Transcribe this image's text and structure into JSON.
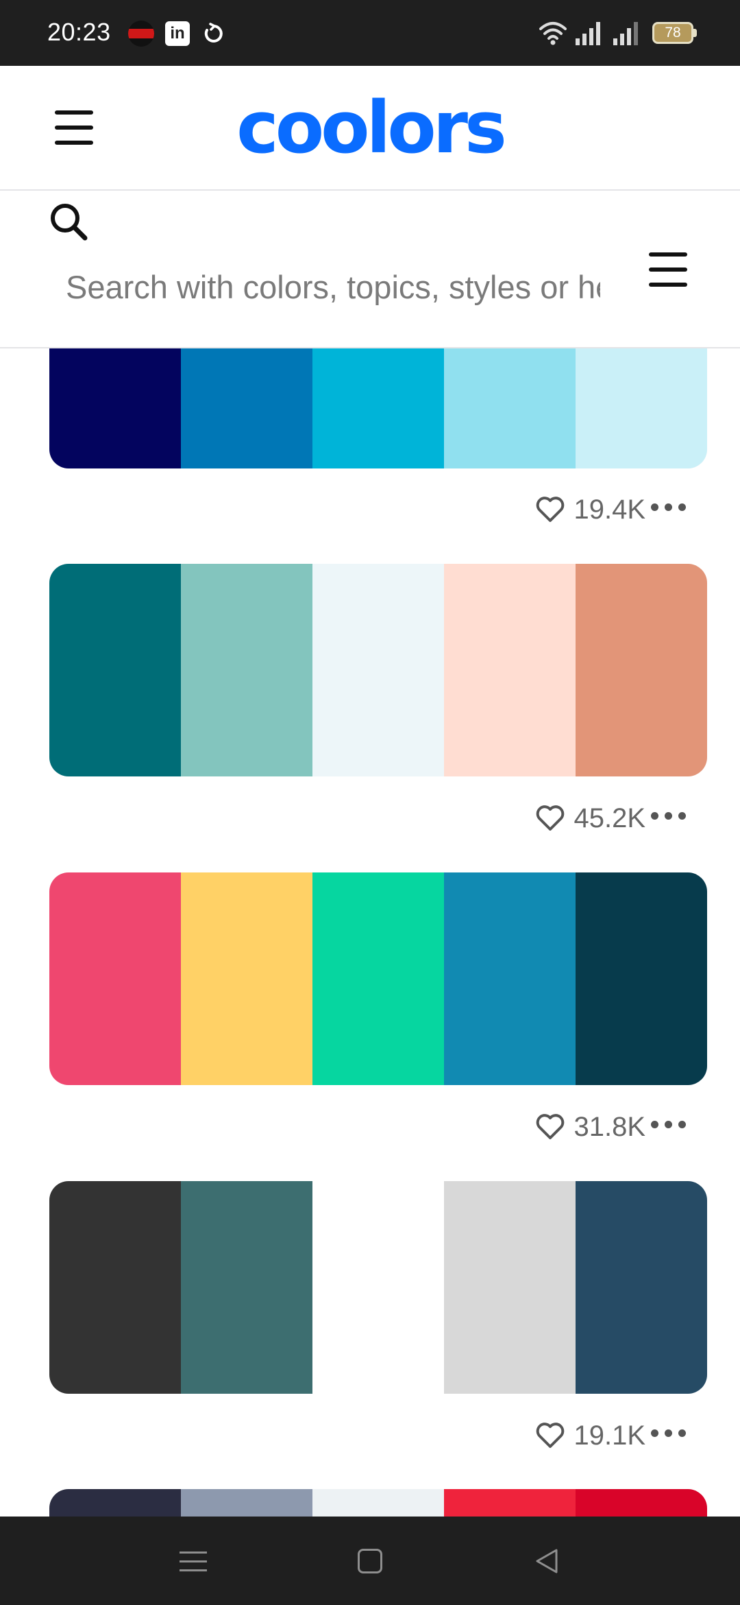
{
  "status_bar": {
    "time": "20:23",
    "battery": "78",
    "icons": [
      "app-notification-icon",
      "linkedin-icon",
      "sync-icon",
      "wifi-icon",
      "signal-icon",
      "signal-icon",
      "battery-icon"
    ]
  },
  "header": {
    "logo": "coolors",
    "menu_icon": "hamburger-menu-icon",
    "brand_color": "#0a6cff"
  },
  "search": {
    "placeholder": "Search with colors, topics, styles or hex values...",
    "search_icon": "search-icon",
    "filter_icon": "hamburger-menu-icon"
  },
  "palettes": [
    {
      "colors": [
        "#03045e",
        "#0077b6",
        "#00b4d8",
        "#90e0ef",
        "#caf0f8"
      ],
      "likes": "19.4K"
    },
    {
      "colors": [
        "#006d77",
        "#83c5be",
        "#edf6f9",
        "#ffddd2",
        "#e29578"
      ],
      "likes": "45.2K"
    },
    {
      "colors": [
        "#ef476f",
        "#ffd166",
        "#06d6a0",
        "#118ab2",
        "#073b4c"
      ],
      "likes": "31.8K"
    },
    {
      "colors": [
        "#333333",
        "#3d6e70",
        "#ffffff",
        "#d8d8d8",
        "#264b65"
      ],
      "likes": "19.1K"
    },
    {
      "colors": [
        "#2b2d42",
        "#8d99ae",
        "#edf2f4",
        "#ef233c",
        "#d90429"
      ],
      "likes": ""
    }
  ],
  "nav_bar": {
    "icons": [
      "recent-apps-icon",
      "home-icon",
      "back-icon"
    ]
  }
}
